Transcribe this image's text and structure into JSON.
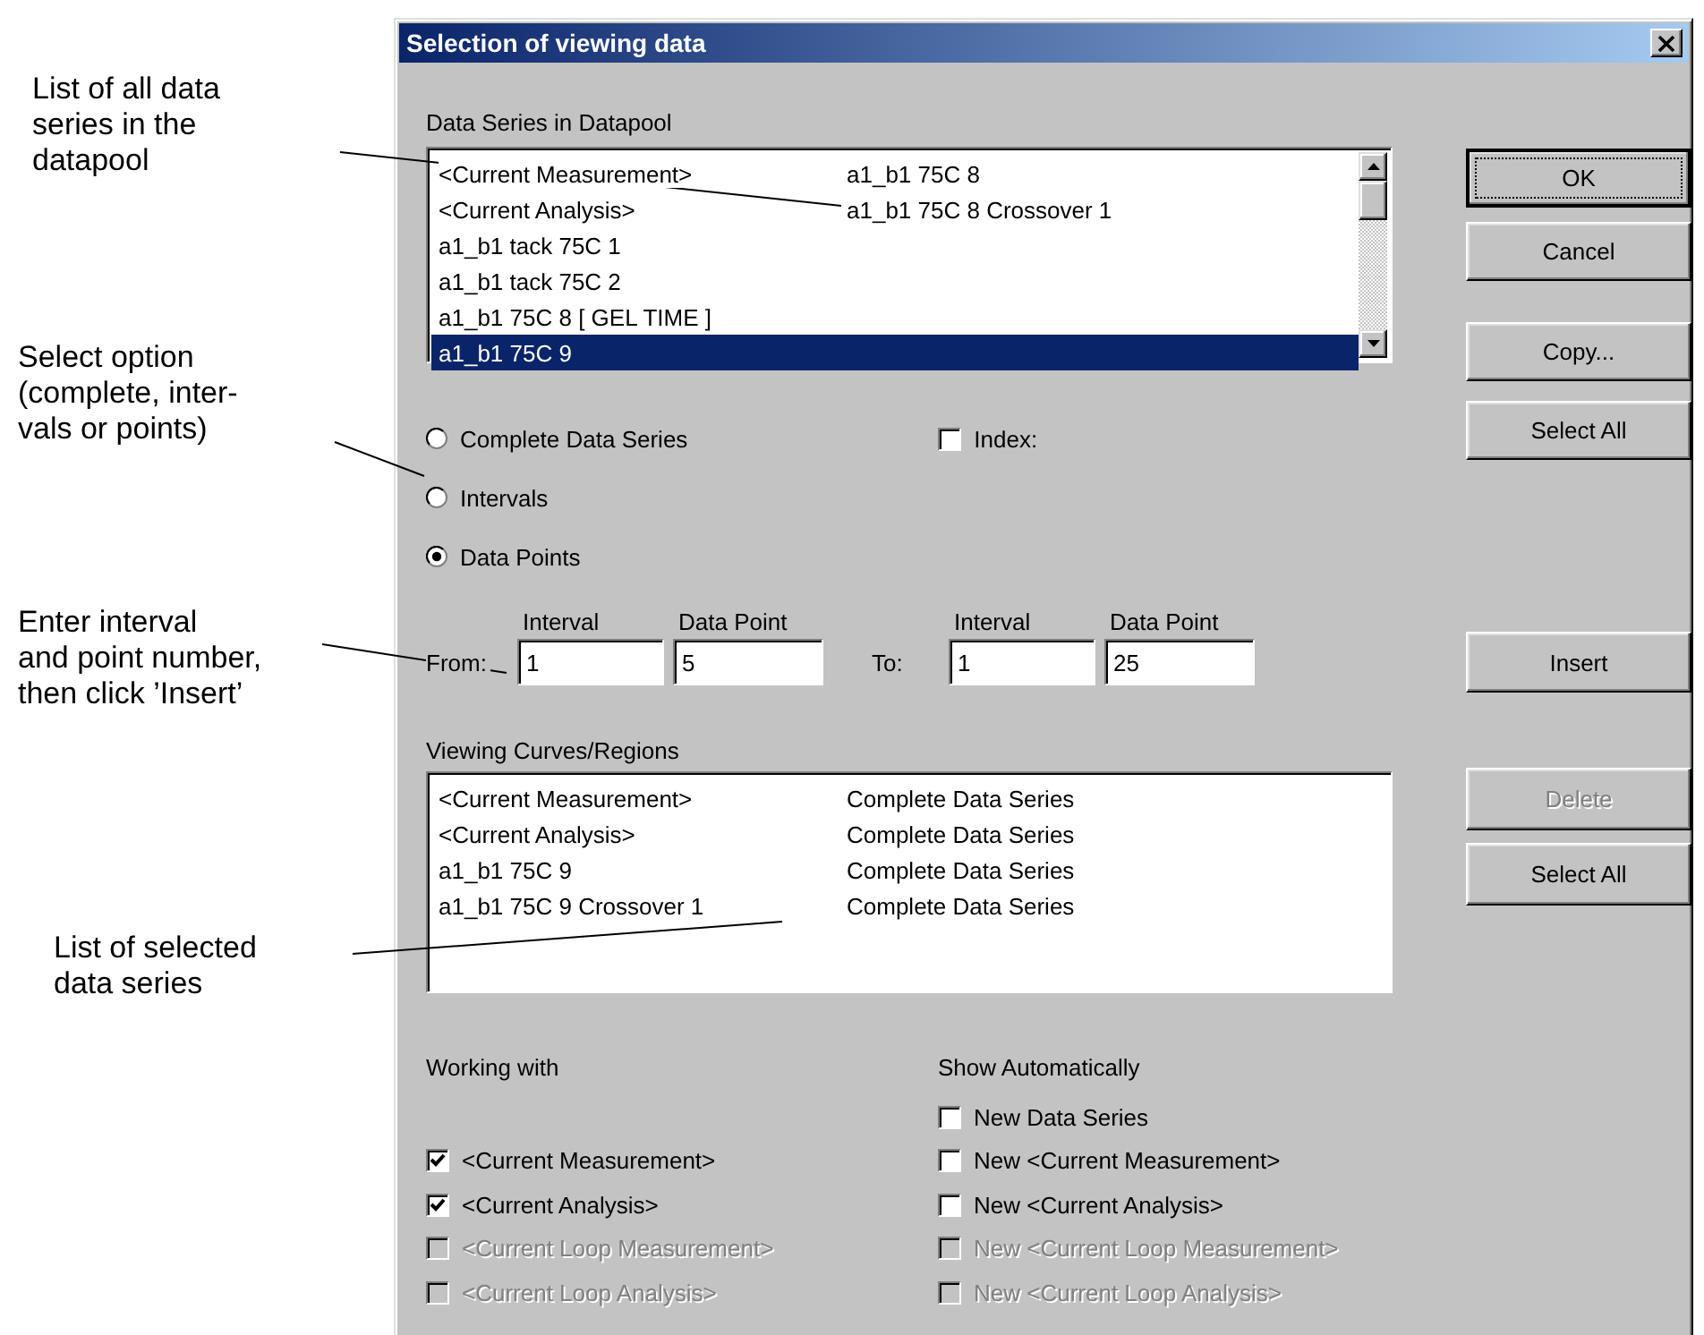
{
  "annotations": [
    {
      "lines": [
        "List of all data",
        "series in the",
        "datapool"
      ]
    },
    {
      "lines": [
        "Select option",
        "(complete, inter-",
        "vals or points)"
      ]
    },
    {
      "lines": [
        "Enter interval",
        "and point number,",
        "then click ’Insert’"
      ]
    },
    {
      "lines": [
        "List of selected",
        "data series"
      ]
    }
  ],
  "window": {
    "title": "Selection of viewing data"
  },
  "datapool": {
    "label": "Data Series in Datapool",
    "rows": [
      {
        "cells": [
          "<Current Measurement>",
          "a1_b1 75C 8"
        ],
        "selected": false
      },
      {
        "cells": [
          "<Current Analysis>",
          "a1_b1 75C 8 Crossover 1"
        ],
        "selected": false
      },
      {
        "cells": [
          "a1_b1 tack 75C 1"
        ],
        "selected": false
      },
      {
        "cells": [
          "a1_b1 tack 75C 2"
        ],
        "selected": false
      },
      {
        "cells": [
          "a1_b1 75C 8 [ GEL TIME ]"
        ],
        "selected": false
      },
      {
        "cells": [
          "a1_b1 75C 9"
        ],
        "selected": true
      }
    ]
  },
  "side_buttons": [
    {
      "label": "OK",
      "focused": true,
      "disabled": false
    },
    {
      "label": "Cancel",
      "focused": false,
      "disabled": false
    },
    {
      "label": "Copy...",
      "focused": false,
      "disabled": false
    },
    {
      "label": "Select All",
      "focused": false,
      "disabled": false
    }
  ],
  "options": [
    {
      "label": "Complete Data Series",
      "selected": false
    },
    {
      "label": "Intervals",
      "selected": false
    },
    {
      "label": "Data Points",
      "selected": true
    }
  ],
  "index": {
    "label": "Index:",
    "checked": false
  },
  "range": {
    "from": {
      "label": "From:",
      "fields": [
        {
          "header": "Interval",
          "value": "1"
        },
        {
          "header": "Data Point",
          "value": "5"
        }
      ]
    },
    "to": {
      "label": "To:",
      "fields": [
        {
          "header": "Interval",
          "value": "1"
        },
        {
          "header": "Data Point",
          "value": "25"
        }
      ]
    },
    "button": "Insert"
  },
  "viewing": {
    "label": "Viewing Curves/Regions",
    "rows": [
      {
        "cells": [
          "<Current Measurement>",
          "Complete Data Series"
        ]
      },
      {
        "cells": [
          "<Current Analysis>",
          "Complete Data Series"
        ]
      },
      {
        "cells": [
          "a1_b1 75C 9",
          "Complete Data Series"
        ]
      },
      {
        "cells": [
          "a1_b1 75C 9 Crossover 1",
          "Complete Data Series"
        ]
      }
    ],
    "buttons": [
      {
        "label": "Delete",
        "disabled": true
      },
      {
        "label": "Select All",
        "disabled": false
      }
    ]
  },
  "working_with": {
    "label": "Working with",
    "items": [
      {
        "label": "<Current Measurement>",
        "checked": true,
        "disabled": false
      },
      {
        "label": "<Current Analysis>",
        "checked": true,
        "disabled": false
      },
      {
        "label": "<Current Loop Measurement>",
        "checked": false,
        "disabled": true
      },
      {
        "label": "<Current Loop Analysis>",
        "checked": false,
        "disabled": true
      }
    ]
  },
  "show_automatically": {
    "label": "Show Automatically",
    "items": [
      {
        "label": "New Data Series",
        "checked": false,
        "disabled": false
      },
      {
        "label": "New <Current Measurement>",
        "checked": false,
        "disabled": false
      },
      {
        "label": "New <Current Analysis>",
        "checked": false,
        "disabled": false
      },
      {
        "label": "New <Current Loop Measurement>",
        "checked": false,
        "disabled": true
      },
      {
        "label": "New <Current Loop Analysis>",
        "checked": false,
        "disabled": true
      }
    ]
  }
}
